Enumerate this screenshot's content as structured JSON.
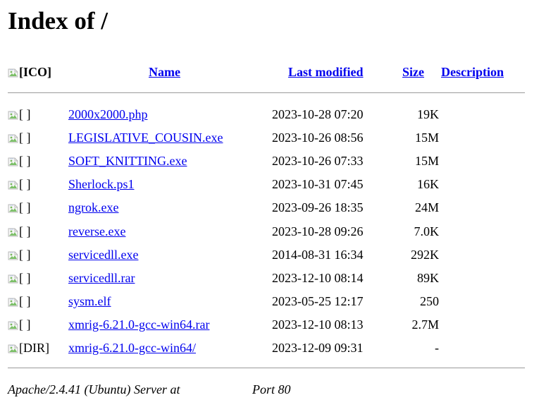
{
  "page": {
    "title": "Index of /"
  },
  "table": {
    "header": {
      "icon_alt": "[ICO]",
      "name": "Name",
      "last_modified": "Last modified",
      "size": "Size",
      "description": "Description"
    },
    "rows": [
      {
        "icon_alt": "[ ]",
        "icon": "broken-image-icon",
        "name": "2000x2000.php",
        "modified": "2023-10-28 07:20",
        "size": "19K",
        "description": ""
      },
      {
        "icon_alt": "[ ]",
        "icon": "broken-image-icon",
        "name": "LEGISLATIVE_COUSIN.exe",
        "modified": "2023-10-26 08:56",
        "size": "15M",
        "description": ""
      },
      {
        "icon_alt": "[ ]",
        "icon": "broken-image-icon",
        "name": "SOFT_KNITTING.exe",
        "modified": "2023-10-26 07:33",
        "size": "15M",
        "description": ""
      },
      {
        "icon_alt": "[ ]",
        "icon": "broken-image-icon",
        "name": "Sherlock.ps1",
        "modified": "2023-10-31 07:45",
        "size": "16K",
        "description": ""
      },
      {
        "icon_alt": "[ ]",
        "icon": "broken-image-icon",
        "name": "ngrok.exe",
        "modified": "2023-09-26 18:35",
        "size": "24M",
        "description": ""
      },
      {
        "icon_alt": "[ ]",
        "icon": "broken-image-icon",
        "name": "reverse.exe",
        "modified": "2023-10-28 09:26",
        "size": "7.0K",
        "description": ""
      },
      {
        "icon_alt": "[ ]",
        "icon": "broken-image-icon",
        "name": "servicedll.exe",
        "modified": "2014-08-31 16:34",
        "size": "292K",
        "description": ""
      },
      {
        "icon_alt": "[ ]",
        "icon": "broken-image-icon",
        "name": "servicedll.rar",
        "modified": "2023-12-10 08:14",
        "size": "89K",
        "description": ""
      },
      {
        "icon_alt": "[ ]",
        "icon": "broken-image-icon",
        "name": "sysm.elf",
        "modified": "2023-05-25 12:17",
        "size": "250",
        "description": ""
      },
      {
        "icon_alt": "[ ]",
        "icon": "broken-image-icon",
        "name": "xmrig-6.21.0-gcc-win64.rar",
        "modified": "2023-12-10 08:13",
        "size": "2.7M",
        "description": ""
      },
      {
        "icon_alt": "[DIR]",
        "icon": "broken-image-icon",
        "name": "xmrig-6.21.0-gcc-win64/",
        "modified": "2023-12-09 09:31",
        "size": "-",
        "description": ""
      }
    ]
  },
  "footer": {
    "server": "Apache/2.4.41 (Ubuntu) Server at",
    "port": "Port 80"
  },
  "colors": {
    "link": "#0000ee",
    "rule": "#9a9a9a",
    "background": "#ffffff",
    "text": "#000000"
  }
}
